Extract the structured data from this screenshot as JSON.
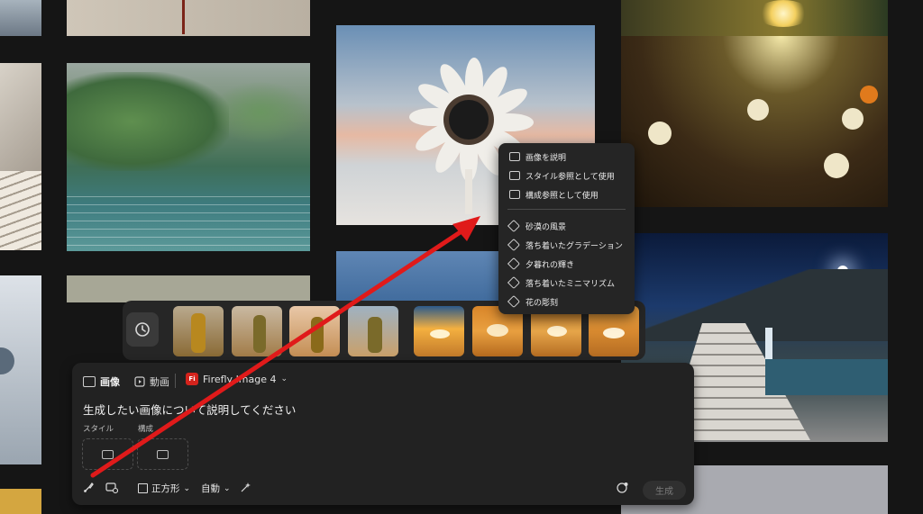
{
  "prompt_panel": {
    "tabs": [
      {
        "label": "画像",
        "icon": "image-icon",
        "active": true
      },
      {
        "label": "動画",
        "icon": "video-icon",
        "active": false
      }
    ],
    "model": {
      "badge": "Fi",
      "name": "Firefly Image 4"
    },
    "prompt_placeholder": "生成したい画像について説明してください",
    "style_label": "スタイル",
    "composition_label": "構成",
    "toolbar": {
      "aspect_label": "正方形",
      "content_label": "自動",
      "generate_label": "生成"
    }
  },
  "context_menu": {
    "actions": [
      {
        "label": "画像を説明",
        "icon": "describe-image-icon"
      },
      {
        "label": "スタイル参照として使用",
        "icon": "image-icon"
      },
      {
        "label": "構成参照として使用",
        "icon": "image-icon"
      }
    ],
    "tags": [
      {
        "label": "砂漠の風景",
        "icon": "tag-icon"
      },
      {
        "label": "落ち着いたグラデーション",
        "icon": "tag-icon"
      },
      {
        "label": "夕暮れの輝き",
        "icon": "tag-icon"
      },
      {
        "label": "落ち着いたミニマリズム",
        "icon": "tag-icon"
      },
      {
        "label": "花の彫刻",
        "icon": "tag-icon"
      }
    ]
  },
  "history": {
    "icon": "history-icon",
    "thumbnail_count": 8
  },
  "colors": {
    "background": "#151515",
    "panel": "#222222",
    "accent_red": "#e01a1a",
    "firefly_badge": "#d4231c"
  }
}
